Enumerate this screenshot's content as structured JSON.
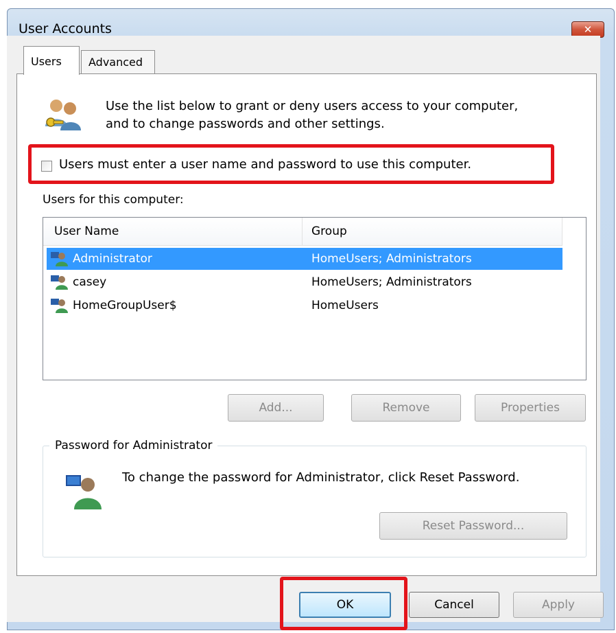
{
  "window": {
    "title": "User Accounts",
    "close_glyph": "✕"
  },
  "tabs": [
    {
      "label": "Users",
      "active": true
    },
    {
      "label": "Advanced",
      "active": false
    }
  ],
  "intro": {
    "icon": "users-keys-icon",
    "line1": "Use the list below to grant or deny users access to your computer,",
    "line2": "and to change passwords and other settings."
  },
  "require_login": {
    "checked": false,
    "label": "Users must enter a user name and password to use this computer."
  },
  "users_section": {
    "heading": "Users for this computer:",
    "columns": [
      "User Name",
      "Group"
    ],
    "rows": [
      {
        "name": "Administrator",
        "group": "HomeUsers; Administrators",
        "selected": true
      },
      {
        "name": "casey",
        "group": "HomeUsers; Administrators",
        "selected": false
      },
      {
        "name": "HomeGroupUser$",
        "group": "HomeUsers",
        "selected": false
      }
    ],
    "buttons": {
      "add": "Add...",
      "remove": "Remove",
      "properties": "Properties"
    }
  },
  "password_group": {
    "title": "Password for Administrator",
    "icon": "user-icon",
    "message": "To change the password for Administrator, click Reset Password.",
    "reset_button": "Reset Password..."
  },
  "dialog_buttons": {
    "ok": "OK",
    "cancel": "Cancel",
    "apply": "Apply"
  },
  "colors": {
    "highlight": "#3399ff",
    "annotation_red": "#e3141b"
  }
}
